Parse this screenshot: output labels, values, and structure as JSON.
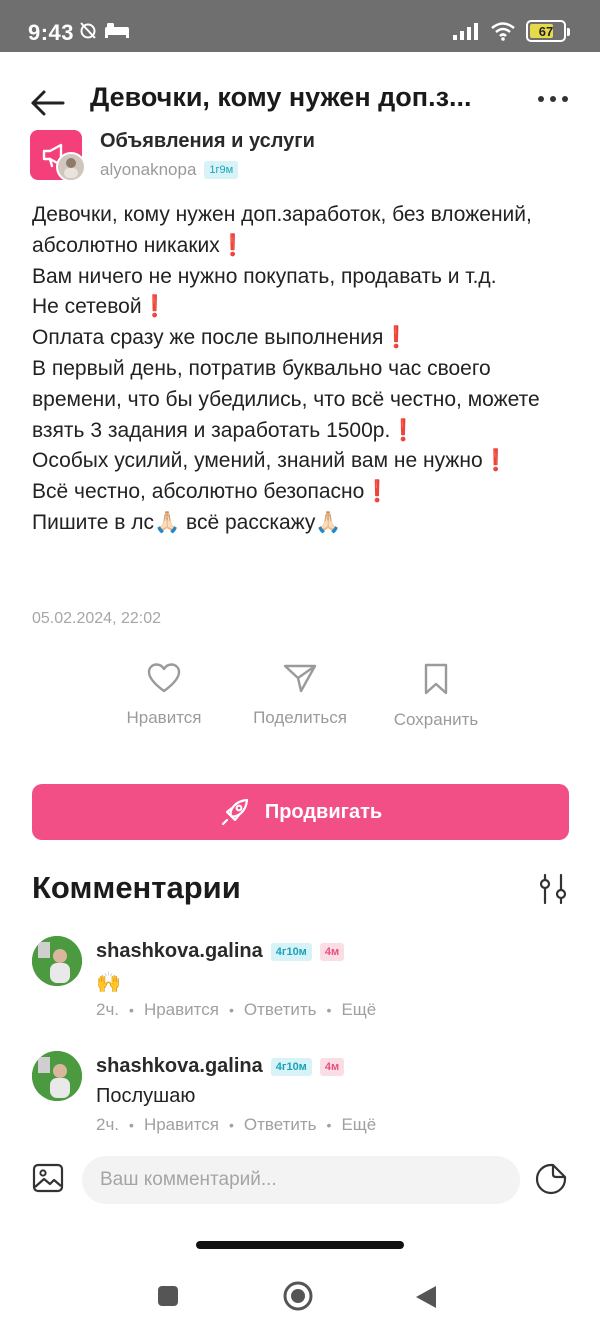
{
  "status_bar": {
    "time": "9:43",
    "battery": "67"
  },
  "header": {
    "title": "Девочки, кому нужен доп.з..."
  },
  "community": {
    "name": "Объявления и услуги",
    "username": "alyonaknopa",
    "badge": "1г9м"
  },
  "post": {
    "text": "Девочки, кому нужен доп.заработок, без вложений, абсолютно никаких❗\nВам ничего не нужно покупать, продавать и т.д.\nНе сетевой❗\nОплата сразу же после выполнения❗\nВ первый день, потратив буквально час своего времени, что бы убедились, что всё честно, можете взять 3 задания и заработать 1500р.❗\nОсобых усилий, умений, знаний вам не нужно❗\nВсё честно, абсолютно безопасно❗\nПишите в лс🙏🏻 всё расскажу🙏🏻",
    "date": "05.02.2024, 22:02"
  },
  "actions": {
    "like": "Нравится",
    "share": "Поделиться",
    "save": "Сохранить"
  },
  "promote_label": "Продвигать",
  "comments": {
    "title": "Комментарии",
    "items": [
      {
        "user": "shashkova.galina",
        "badge1": "4г10м",
        "badge2": "4м",
        "text": "🙌",
        "time": "2ч.",
        "like": "Нравится",
        "reply": "Ответить",
        "more": "Ещё"
      },
      {
        "user": "shashkova.galina",
        "badge1": "4г10м",
        "badge2": "4м",
        "text": "Послушаю",
        "time": "2ч.",
        "like": "Нравится",
        "reply": "Ответить",
        "more": "Ещё"
      }
    ]
  },
  "composer": {
    "placeholder": "Ваш комментарий..."
  },
  "colors": {
    "accent": "#f24f86",
    "status_bar": "#6f6f6f",
    "badge_blue": "#1aa3b8",
    "badge_pink": "#e8507d"
  }
}
